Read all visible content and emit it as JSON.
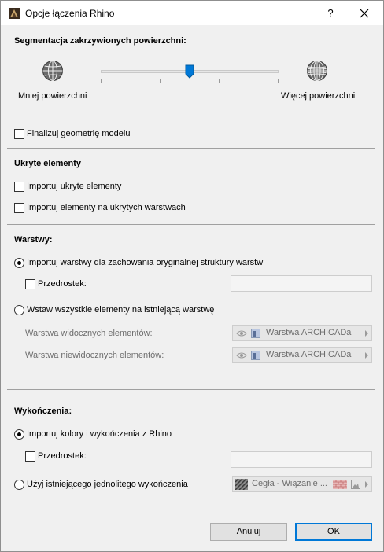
{
  "window": {
    "title": "Opcje łączenia Rhino",
    "help_label": "?"
  },
  "segmentation": {
    "title": "Segmentacja zakrzywionych powierzchni:",
    "less_label": "Mniej powierzchni",
    "more_label": "Więcej powierzchni",
    "slider_level_fraction": 0.5,
    "ticks": 7
  },
  "finalize": {
    "label": "Finalizuj geometrię modelu",
    "checked": false
  },
  "hidden": {
    "title": "Ukryte elementy",
    "import_hidden_label": "Importuj ukryte elementy",
    "import_hidden_layers_label": "Importuj elementy na ukrytych warstwach"
  },
  "layers": {
    "title": "Warstwy:",
    "option1_label": "Importuj warstwy dla zachowania oryginalnej struktury warstw",
    "prefix_label": "Przedrostek:",
    "option2_label": "Wstaw wszystkie elementy na istniejącą warstwę",
    "visible_label": "Warstwa widocznych elementów:",
    "invisible_label": "Warstwa niewidocznych elementów:",
    "layer_value": "Warstwa ARCHICADa"
  },
  "finishes": {
    "title": "Wykończenia:",
    "option1_label": "Importuj kolory i wykończenia z Rhino",
    "prefix_label": "Przedrostek:",
    "option2_label": "Użyj istniejącego jednolitego wykończenia",
    "surface_value": "Cegła - Wiązanie ..."
  },
  "buttons": {
    "cancel": "Anuluj",
    "ok": "OK"
  }
}
